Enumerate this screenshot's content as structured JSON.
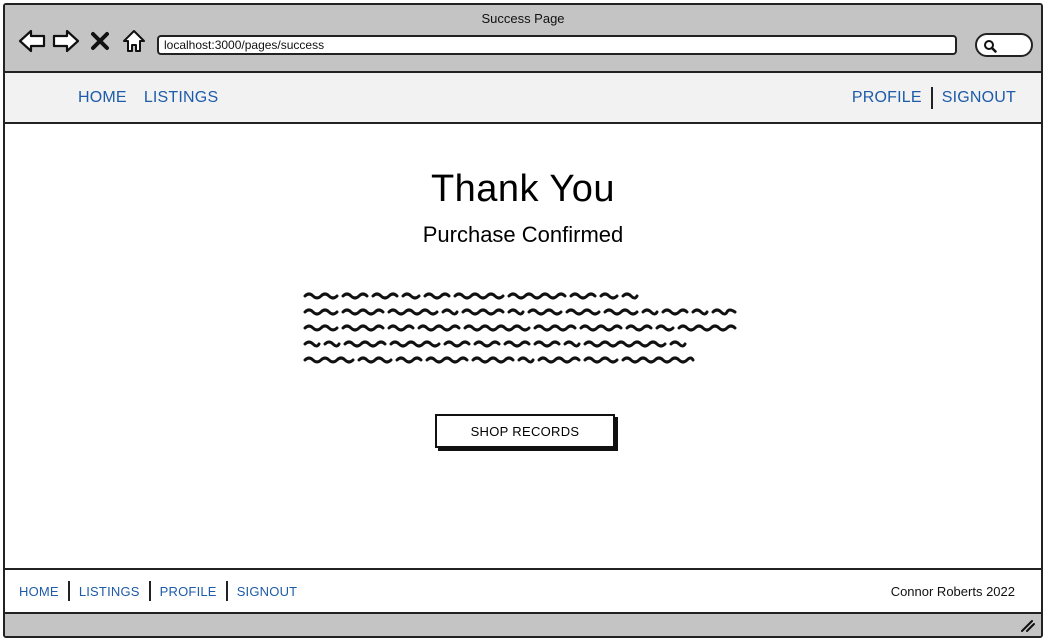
{
  "window": {
    "title": "Success Page"
  },
  "browser": {
    "url": "localhost:3000/pages/success",
    "icons": [
      "back-arrow-icon",
      "forward-arrow-icon",
      "close-x-icon",
      "home-icon",
      "search-icon"
    ]
  },
  "header": {
    "left_links": [
      "HOME",
      "LISTINGS"
    ],
    "right_links": [
      "PROFILE",
      "SIGNOUT"
    ]
  },
  "main": {
    "title": "Thank You",
    "subtitle": "Purchase Confirmed",
    "button_label": "SHOP RECORDS"
  },
  "footer": {
    "links": [
      "HOME",
      "LISTINGS",
      "PROFILE",
      "SIGNOUT"
    ],
    "copyright": "Connor Roberts 2022"
  },
  "colors": {
    "link": "#1e5ba8",
    "chrome": "#c4c4c4",
    "header_bg": "#f2f2f2"
  }
}
